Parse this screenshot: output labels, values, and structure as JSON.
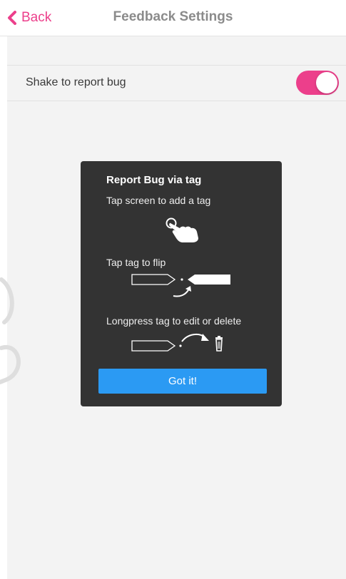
{
  "header": {
    "back_label": "Back",
    "title": "Feedback Settings"
  },
  "settings": {
    "shake_label": "Shake to report bug",
    "shake_enabled": true
  },
  "popup": {
    "title": "Report Bug via tag",
    "step1": "Tap screen to add a tag",
    "step2": "Tap tag to flip",
    "step3": "Longpress tag to edit or delete",
    "button_label": "Got it!"
  },
  "colors": {
    "accent": "#ec3f8b",
    "button": "#2b9af3",
    "card": "#333333",
    "background": "#f3f3f3"
  }
}
